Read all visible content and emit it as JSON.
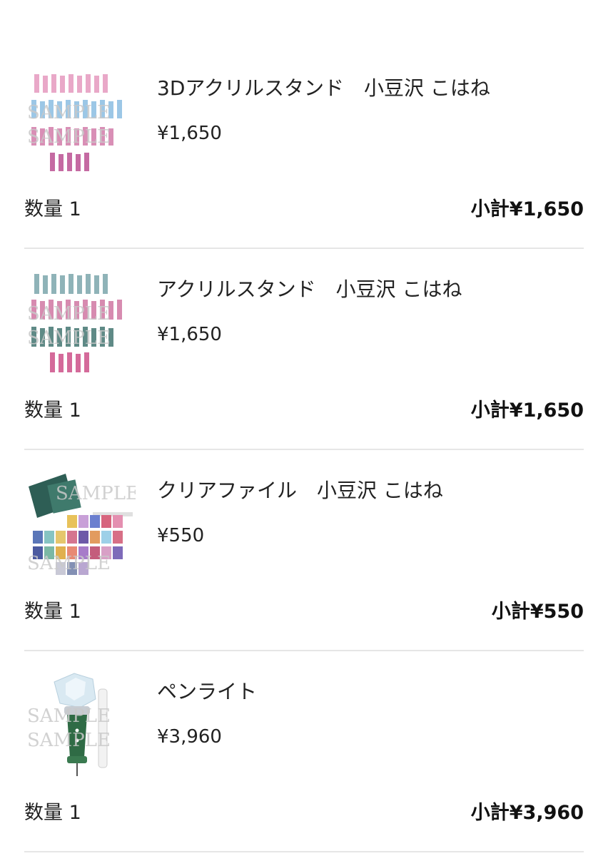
{
  "cart": {
    "items": [
      {
        "name": "3Dアクリルスタンド　小豆沢 こはね",
        "price": "¥1,650",
        "quantity": "数量 1",
        "subtotal": "小計¥1,650",
        "thumbnail": "acrylic-stand-3d-image"
      },
      {
        "name": "アクリルスタンド　小豆沢 こはね",
        "price": "¥1,650",
        "quantity": "数量 1",
        "subtotal": "小計¥1,650",
        "thumbnail": "acrylic-stand-image"
      },
      {
        "name": "クリアファイル　小豆沢 こはね",
        "price": "¥550",
        "quantity": "数量 1",
        "subtotal": "小計¥550",
        "thumbnail": "clear-file-image"
      },
      {
        "name": "ペンライト",
        "price": "¥3,960",
        "quantity": "数量 1",
        "subtotal": "小計¥3,960",
        "thumbnail": "penlight-image"
      }
    ],
    "watermark": "SAMPLE"
  },
  "colors": {
    "divider": "#e6e6e6",
    "text": "#222222",
    "penlight_handle": "#2f6b45"
  }
}
